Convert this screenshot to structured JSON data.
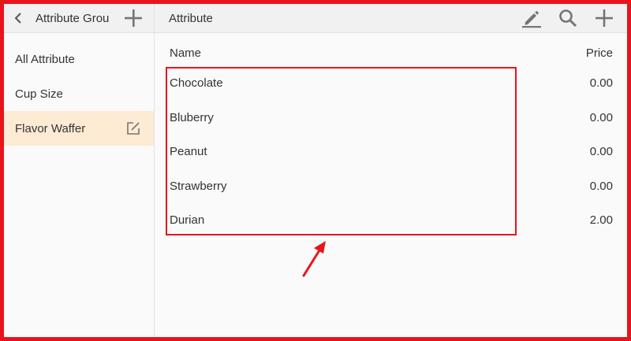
{
  "sidebar": {
    "title": "Attribute Grou",
    "items": [
      {
        "label": "All Attribute"
      },
      {
        "label": "Cup Size"
      },
      {
        "label": "Flavor Waffer",
        "selected": true
      }
    ]
  },
  "main": {
    "title": "Attribute",
    "columns": {
      "name": "Name",
      "price": "Price"
    },
    "rows": [
      {
        "name": "Chocolate",
        "price": "0.00"
      },
      {
        "name": "Bluberry",
        "price": "0.00"
      },
      {
        "name": "Peanut",
        "price": "0.00"
      },
      {
        "name": "Strawberry",
        "price": "0.00"
      },
      {
        "name": "Durian",
        "price": "2.00"
      }
    ]
  },
  "icons": {
    "back": "chevron-left-icon",
    "add": "plus-icon",
    "edit": "pencil-icon",
    "search": "search-icon",
    "edit_item": "edit-square-icon"
  },
  "colors": {
    "annotation": "#e8141c",
    "selected_bg": "#fdebd3",
    "toolbar_bg": "#f1f1f1",
    "icon": "#757575"
  }
}
